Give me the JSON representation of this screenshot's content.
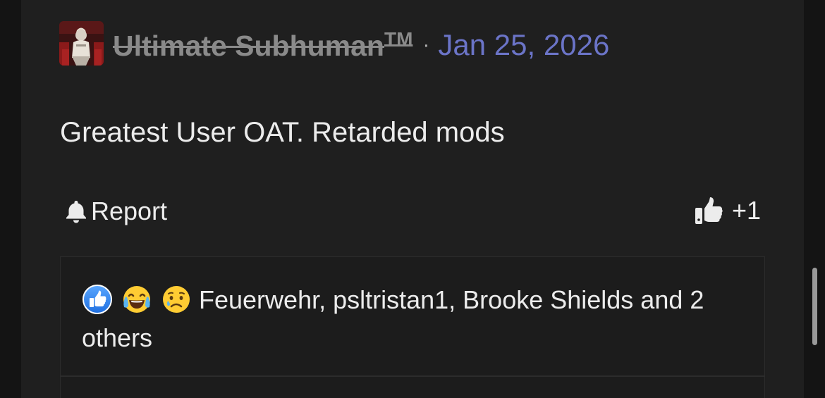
{
  "post": {
    "author": "Ultimate Subhuman",
    "author_mark": "TM",
    "separator": "·",
    "date": "Jan 25, 2026",
    "body": "Greatest User OAT. Retarded mods"
  },
  "actions": {
    "report_label": "Report",
    "report_icon": "bell-icon",
    "like_icon": "thumbs-up-icon",
    "like_count": "+1"
  },
  "reactions": {
    "icons": [
      "like-reaction-icon",
      "laughing-crying-reaction-icon",
      "sad-reaction-icon"
    ],
    "text": "Feuerwehr, psltristan1, Brooke Shields and 2 others"
  },
  "colors": {
    "background": "#1f1f1f",
    "date": "#6b74c7",
    "username": "#8a8a8a",
    "text": "#ececec"
  }
}
